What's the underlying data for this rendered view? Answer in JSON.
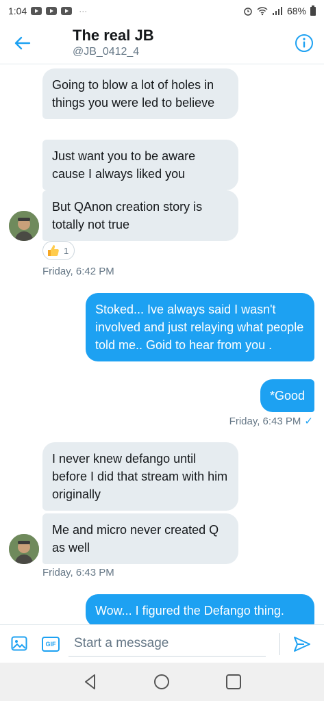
{
  "status_bar": {
    "time": "1:04",
    "battery": "68%",
    "more": "···"
  },
  "header": {
    "title": "The real JB",
    "handle": "@JB_0412_4"
  },
  "messages": {
    "in1": "Going to blow a lot of holes in things you were led to believe",
    "in2": "Just want you to be aware cause I always liked you",
    "in3": "But QAnon creation story is totally not true",
    "reaction_count": "1",
    "time1": "Friday, 6:42 PM",
    "out1": "Stoked... Ive always said I wasn't involved and just relaying what people told me.. Goid to hear from you .",
    "out2": "*Good",
    "time2": "Friday, 6:43 PM",
    "time2_check": "✓",
    "in4": "I never knew defango until before I did that stream with him originally",
    "in5": "Me and micro never created Q as well",
    "time3": "Friday, 6:43 PM",
    "out3": "Wow... I figured the Defango thing."
  },
  "composer": {
    "placeholder": "Start a message",
    "gif_label": "GIF"
  },
  "colors": {
    "accent": "#1da1f2",
    "incoming_bubble": "#e6ecf0",
    "muted_text": "#657786"
  },
  "icons": {
    "back": "arrow-left-icon",
    "info": "info-icon",
    "media": "image-icon",
    "gif": "gif-icon",
    "send": "send-icon",
    "reaction": "thumbs-up-icon"
  }
}
